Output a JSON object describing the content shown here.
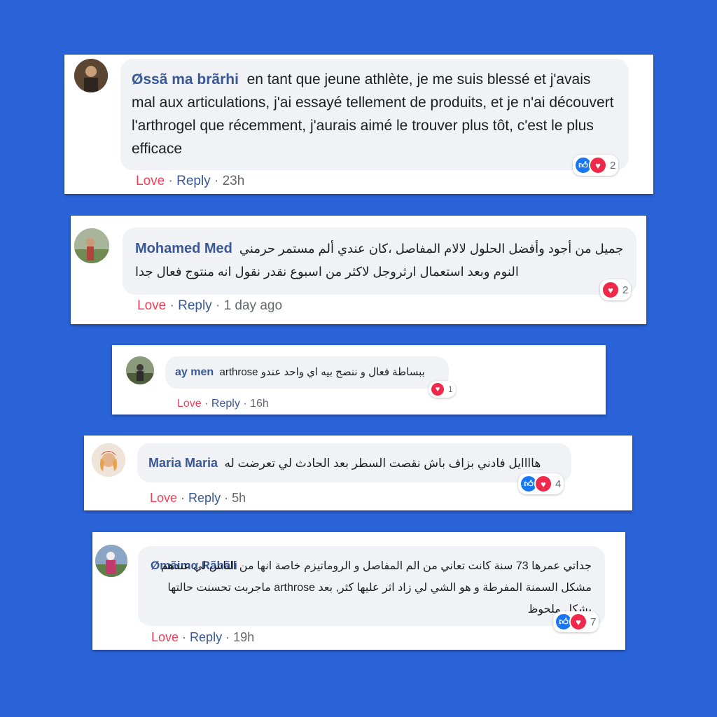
{
  "comments": [
    {
      "author": "Øssã ma brãrhi",
      "text": "en tant que jeune athlète, je me suis blessé et j'avais mal aux articulations, j'ai essayé tellement de produits, et je n'ai découvert l'arthrogel que récemment, j'aurais aimé le trouver plus tôt, c'est le plus efficace",
      "reaction_count": "2",
      "reactions": [
        "like",
        "love"
      ],
      "love_label": "Love",
      "reply_label": "Reply",
      "time": "23h"
    },
    {
      "author": "Mohamed Med",
      "text": "جميل من أجود وأفضل الحلول لالام المفاصل ،كان عندي ألم مستمر حرمني النوم وبعد استعمال ارثروجل لاكثر من اسبوع نقدر نقول انه منتوج فعال جدا",
      "reaction_count": "2",
      "reactions": [
        "love"
      ],
      "love_label": "Love",
      "reply_label": "Reply",
      "time": "1 day ago"
    },
    {
      "author": "ay men",
      "text": "arthrose ببساطة فعال و ننصح بيه اي واحد عندو",
      "reaction_count": "1",
      "reactions": [
        "love"
      ],
      "love_label": "Love",
      "reply_label": "Reply",
      "time": "16h"
    },
    {
      "author": "Maria Maria",
      "text": "هاااايل فادني بزاف باش نقصت السطر بعد الحادث لي تعرضت له",
      "reaction_count": "4",
      "reactions": [
        "like",
        "love"
      ],
      "love_label": "Love",
      "reply_label": "Reply",
      "time": "5h"
    },
    {
      "author": "Ømãimα Rãhãli",
      "text": "جداتي عمرها 73 سنة كانت تعاني من الم المفاصل و الروماتيزم خاصة انها من الناس لي عندهم مشكل السمنة المفرطة و هو الشي لي زاد اثر عليها كثر, بعد arthrose ماجربت تحسنت حالتها بشكل ملحوظ",
      "reaction_count": "7",
      "reactions": [
        "like",
        "love"
      ],
      "love_label": "Love",
      "reply_label": "Reply",
      "time": "19h"
    }
  ],
  "colors": {
    "background": "#2a63d8",
    "author": "#385898",
    "love_action": "#f33e58",
    "like_icon": "#1877f2",
    "love_icon": "#f0284a"
  },
  "icons": [
    "thumbs-up-icon",
    "heart-icon"
  ]
}
